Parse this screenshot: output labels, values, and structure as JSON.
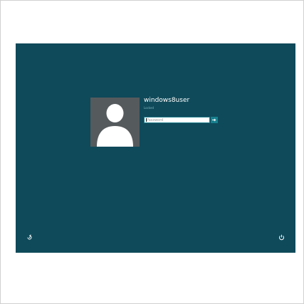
{
  "login": {
    "username": "windows8user",
    "status": "Locked",
    "password_placeholder": "Password"
  },
  "icons": {
    "avatar": "user-silhouette-icon",
    "submit": "arrow-right-icon",
    "ease_of_access": "ease-of-access-icon",
    "power": "power-icon"
  },
  "colors": {
    "background": "#0f4a5a",
    "avatar_tile": "#555a5c",
    "accent": "#18818f",
    "status_text": "#7fb1bd"
  }
}
